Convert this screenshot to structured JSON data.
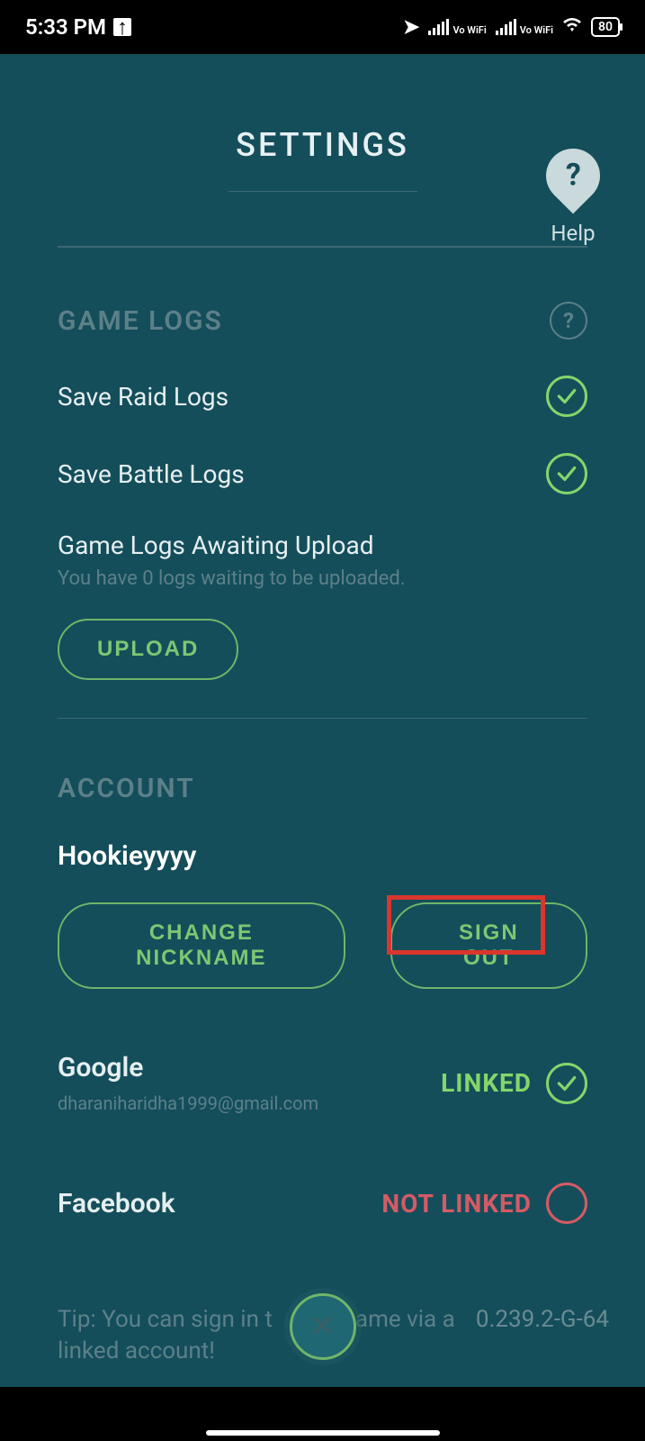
{
  "status_bar": {
    "time": "5:33 PM",
    "vowifi": "Vo\nWiFi",
    "battery": "80"
  },
  "header": {
    "title": "SETTINGS",
    "help_label": "Help"
  },
  "game_logs": {
    "section_title": "GAME LOGS",
    "save_raid_label": "Save Raid Logs",
    "save_battle_label": "Save Battle Logs",
    "awaiting_title": "Game Logs Awaiting Upload",
    "awaiting_sub": "You have 0 logs waiting to be uploaded.",
    "upload_label": "UPLOAD"
  },
  "account": {
    "section_title": "ACCOUNT",
    "nickname": "Hookieyyyy",
    "change_nickname_label": "CHANGE NICKNAME",
    "sign_out_label": "SIGN OUT",
    "providers": {
      "google": {
        "name": "Google",
        "status": "LINKED",
        "email": "dharaniharidha1999@gmail.com"
      },
      "facebook": {
        "name": "Facebook",
        "status": "NOT LINKED"
      }
    }
  },
  "footer": {
    "tip_line1": "Tip: You can sign in t",
    "tip_line2": "game via a",
    "tip_line3": "linked account!",
    "version": "0.239.2-G-64"
  }
}
